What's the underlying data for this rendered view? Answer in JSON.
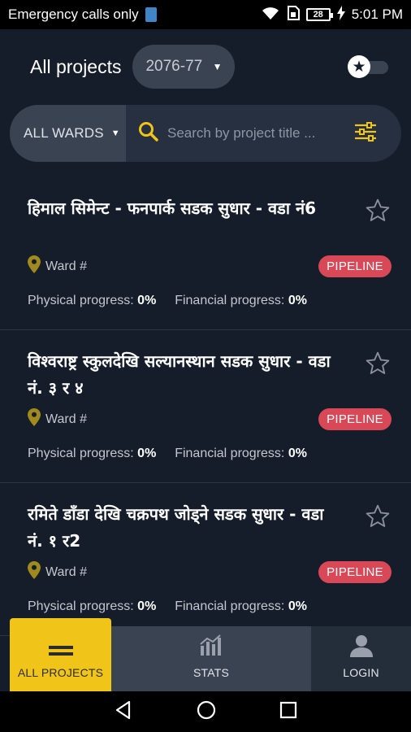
{
  "status_bar": {
    "carrier_text": "Emergency calls only",
    "battery_level": "28",
    "time": "5:01 PM",
    "icons": [
      "sim-icon",
      "wifi-icon",
      "sim-card-icon",
      "battery-icon",
      "charging-icon"
    ]
  },
  "header": {
    "title": "All projects",
    "year_selected": "2076-77",
    "favorites_toggle_icon": "star-icon"
  },
  "search": {
    "ward_filter": "ALL WARDS",
    "placeholder": "Search by project title ..."
  },
  "projects": [
    {
      "title": "हिमाल सिमेन्ट - फनपार्क सडक सुधार - वडा नं6",
      "ward_label": "Ward #",
      "status": "PIPELINE",
      "physical_label": "Physical progress:",
      "physical_value": "0%",
      "financial_label": "Financial progress:",
      "financial_value": "0%"
    },
    {
      "title": "विश्वराष्ट्र स्कुलदेखि सल्यानस्थान सडक सुधार - वडा नं. ३ र ४",
      "ward_label": "Ward #",
      "status": "PIPELINE",
      "physical_label": "Physical progress:",
      "physical_value": "0%",
      "financial_label": "Financial progress:",
      "financial_value": "0%"
    },
    {
      "title": "रमिते डाँडा देखि चक्रपथ जोड्ने सडक सुधार - वडा नं. १ र2",
      "ward_label": "Ward #",
      "status": "PIPELINE",
      "physical_label": "Physical progress:",
      "physical_value": "0%",
      "financial_label": "Financial progress:",
      "financial_value": "0%"
    }
  ],
  "bottom_nav": {
    "all_projects": "ALL PROJECTS",
    "stats": "STATS",
    "login": "LOGIN"
  },
  "colors": {
    "background": "#141d29",
    "accent_yellow": "#f0c419",
    "badge_red": "#d94857",
    "pin_gold": "#a08a1e"
  }
}
